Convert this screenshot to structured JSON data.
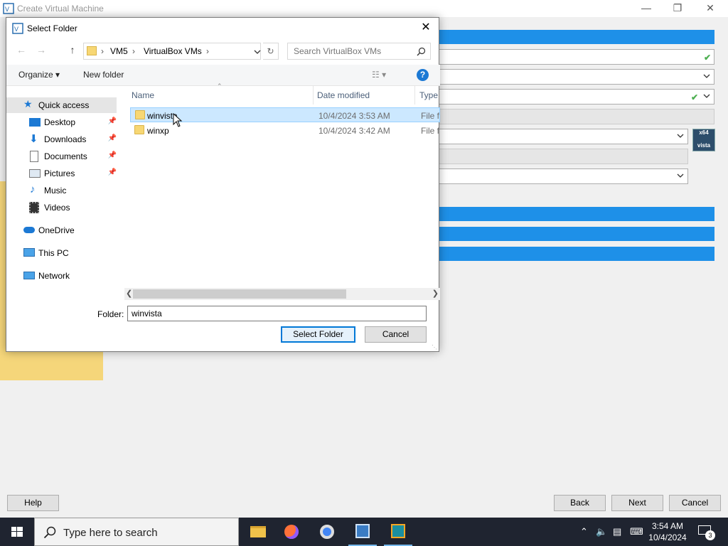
{
  "background_window": {
    "title": "Create Virtual Machine",
    "buttons": {
      "help": "Help",
      "back": "Back",
      "next": "Next",
      "cancel": "Cancel"
    },
    "os_icon_text": "x64\nvista"
  },
  "dialog": {
    "title": "Select Folder",
    "breadcrumb": [
      "VM5",
      "VirtualBox VMs"
    ],
    "search_placeholder": "Search VirtualBox VMs",
    "toolbar": {
      "organize": "Organize",
      "new_folder": "New folder"
    },
    "nav_items": [
      {
        "label": "Quick access",
        "icon": "star-icon",
        "selected": true
      },
      {
        "label": "Desktop",
        "icon": "desktop-icon",
        "pinned": true
      },
      {
        "label": "Downloads",
        "icon": "download-icon",
        "pinned": true
      },
      {
        "label": "Documents",
        "icon": "document-icon",
        "pinned": true
      },
      {
        "label": "Pictures",
        "icon": "pictures-icon",
        "pinned": true
      },
      {
        "label": "Music",
        "icon": "music-icon"
      },
      {
        "label": "Videos",
        "icon": "video-icon"
      },
      {
        "label": "OneDrive",
        "icon": "cloud-icon"
      },
      {
        "label": "This PC",
        "icon": "computer-icon"
      },
      {
        "label": "Network",
        "icon": "network-icon"
      }
    ],
    "columns": {
      "name": "Name",
      "date": "Date modified",
      "type": "Type"
    },
    "files": [
      {
        "name": "winvista",
        "date": "10/4/2024 3:53 AM",
        "type": "File f",
        "selected": true
      },
      {
        "name": "winxp",
        "date": "10/4/2024 3:42 AM",
        "type": "File f",
        "selected": false
      }
    ],
    "folder_label": "Folder:",
    "folder_value": "winvista",
    "select_button": "Select Folder",
    "cancel_button": "Cancel"
  },
  "taskbar": {
    "search_placeholder": "Type here to search",
    "time": "3:54 AM",
    "date": "10/4/2024",
    "notification_count": "3"
  }
}
